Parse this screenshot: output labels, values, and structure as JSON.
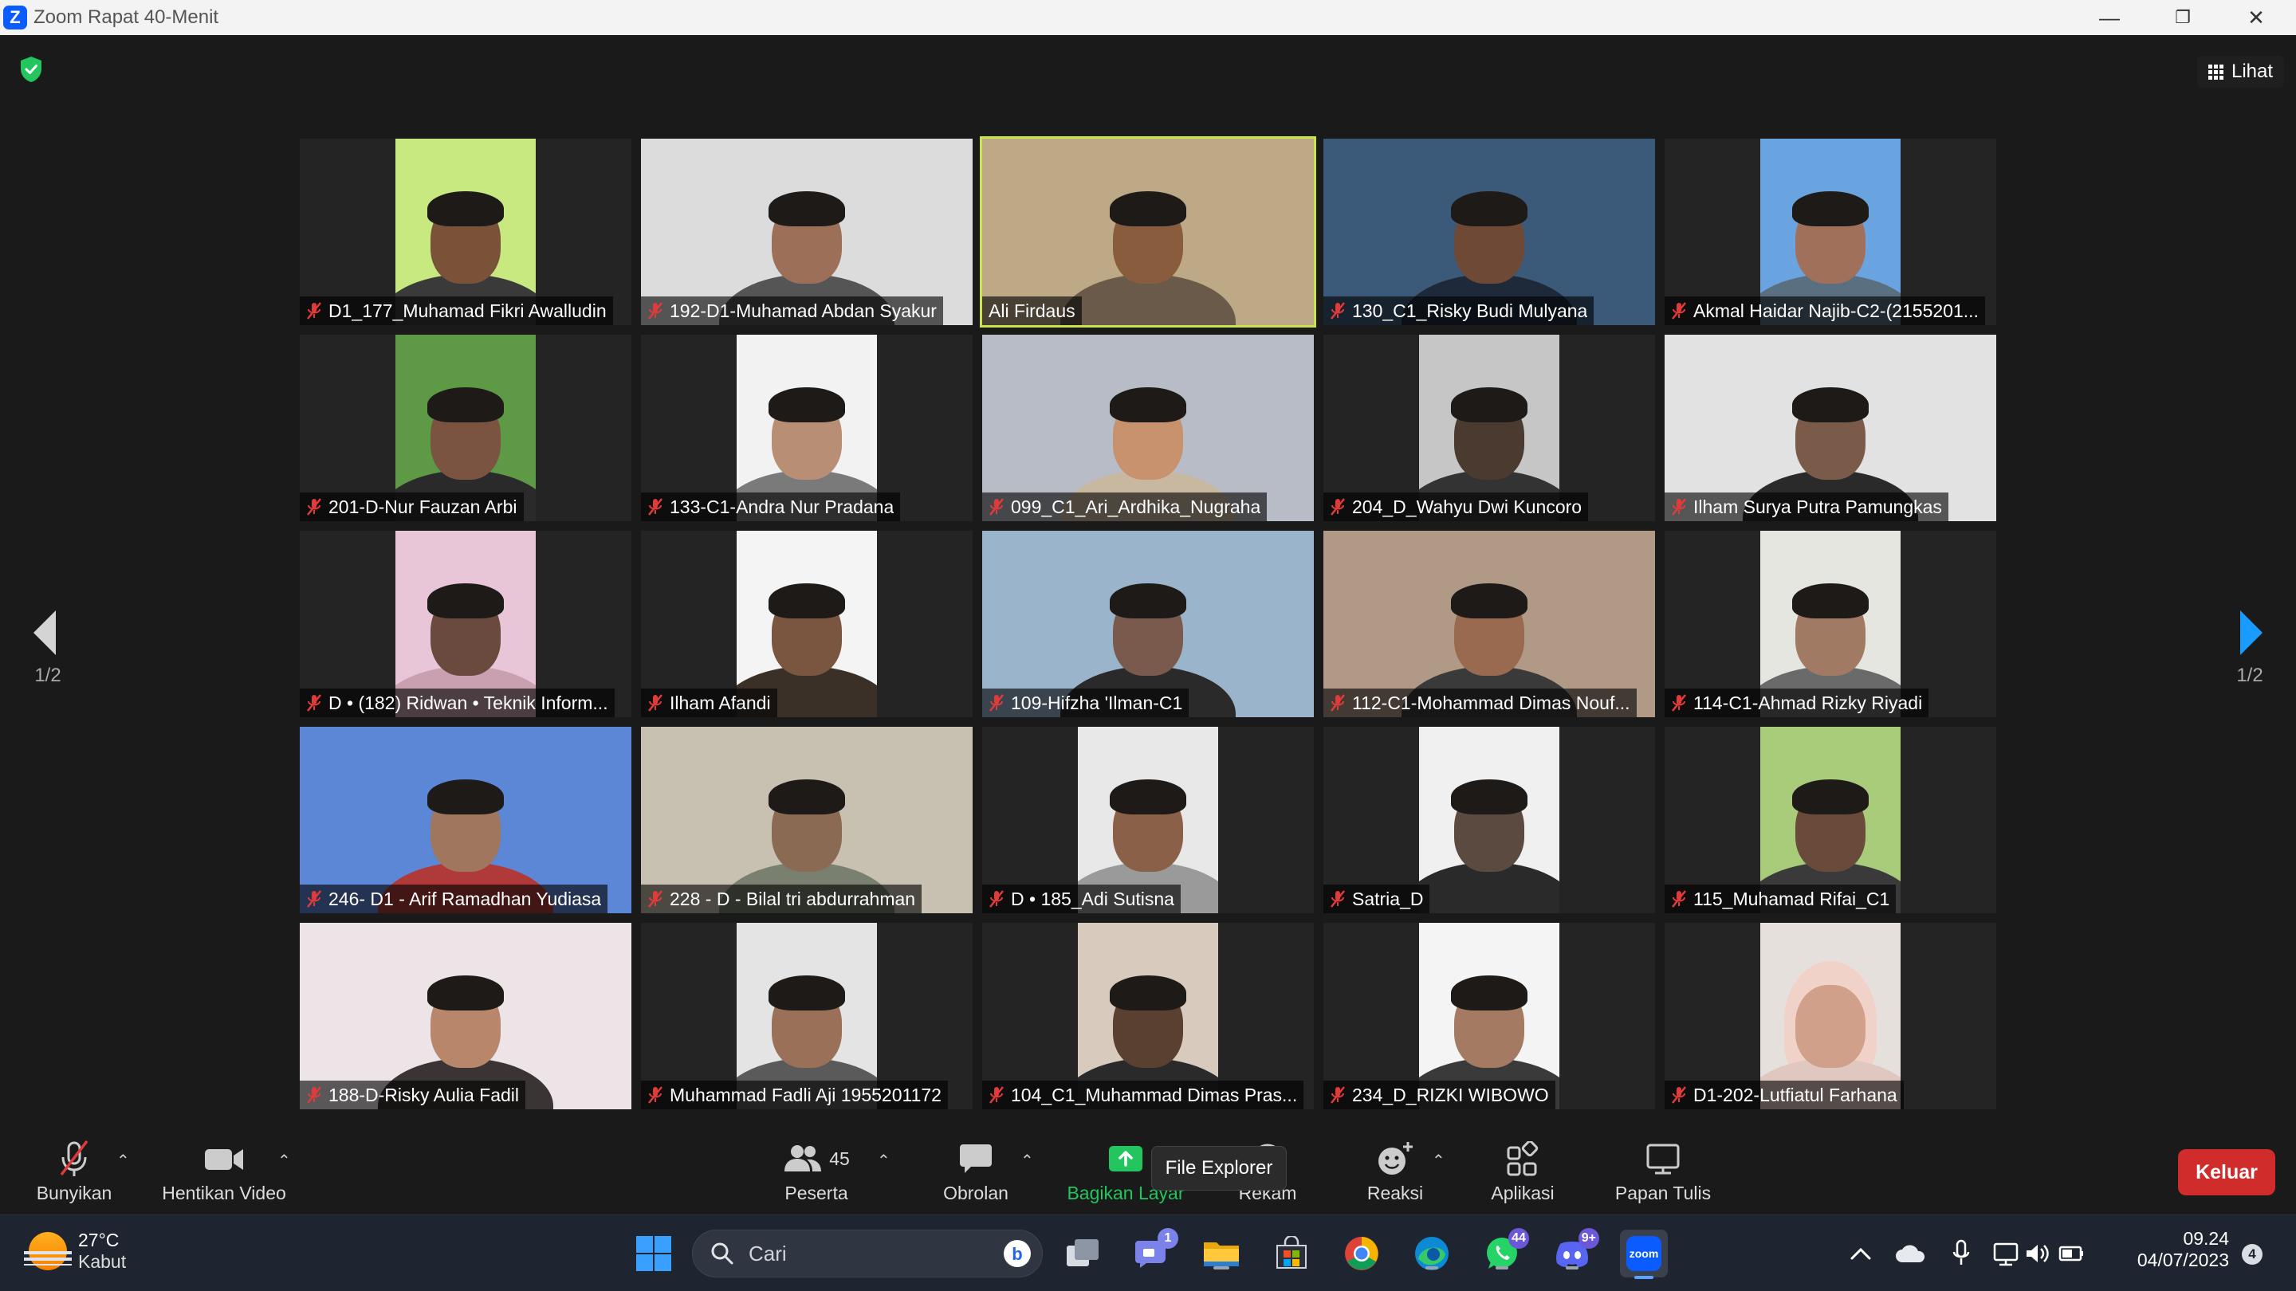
{
  "window": {
    "title": "Zoom Rapat 40-Menit",
    "logo_letter": "Z",
    "minimize": "—",
    "restore": "❐",
    "close": "✕"
  },
  "view_button": {
    "label": "Lihat"
  },
  "pagination": {
    "left": "1/2",
    "right": "1/2"
  },
  "participants": [
    {
      "name": "D1_177_Muhamad Fikri Awalludin",
      "bg": "#c8e880",
      "skin": "#7a5238",
      "shirt": "#3a3a3a",
      "wide": false
    },
    {
      "name": "192-D1-Muhamad Abdan Syakur",
      "bg": "#dcdcdc",
      "skin": "#9c7058",
      "shirt": "#555555",
      "wide": true
    },
    {
      "name": "Ali Firdaus",
      "bg": "#bda985",
      "skin": "#8a5c3e",
      "shirt": "#6a5a4a",
      "wide": true
    },
    {
      "name": "130_C1_Risky Budi Mulyana",
      "bg": "#3b5a7a",
      "skin": "#6e4a36",
      "shirt": "#1e2a3a",
      "wide": true
    },
    {
      "name": "Akmal Haidar Najib-C2-(2155201...",
      "bg": "#6aa4e0",
      "skin": "#a0705a",
      "shirt": "#5a7080",
      "wide": false
    },
    {
      "name": "201-D-Nur Fauzan Arbi",
      "bg": "#5e9a46",
      "skin": "#7a5440",
      "shirt": "#2a2a2a",
      "wide": false
    },
    {
      "name": "133-C1-Andra Nur Pradana",
      "bg": "#f2f2f2",
      "skin": "#b88e74",
      "shirt": "#7a7a7a",
      "wide": false
    },
    {
      "name": "099_C1_Ari_Ardhika_Nugraha",
      "bg": "#b8bcc6",
      "skin": "#c8926e",
      "shirt": "#c8b8a0",
      "wide": true
    },
    {
      "name": "204_D_Wahyu Dwi Kuncoro",
      "bg": "#c6c6c6",
      "skin": "#4a3a30",
      "shirt": "#333333",
      "wide": false
    },
    {
      "name": "Ilham Surya Putra Pamungkas",
      "bg": "#e2e2e2",
      "skin": "#7a5a48",
      "shirt": "#2a2a2a",
      "wide": true
    },
    {
      "name": "D • (182) Ridwan • Teknik Inform...",
      "bg": "#e8c6d8",
      "skin": "#6a4a3e",
      "shirt": "#c8a0b0",
      "wide": false
    },
    {
      "name": "Ilham Afandi",
      "bg": "#f4f4f4",
      "skin": "#7a5640",
      "shirt": "#3a3028",
      "wide": false
    },
    {
      "name": "109-Hifzha 'Ilman-C1",
      "bg": "#9ab4cc",
      "skin": "#7a5a4c",
      "shirt": "#2a2a2a",
      "wide": true
    },
    {
      "name": "112-C1-Mohammad Dimas Nouf...",
      "bg": "#b09a86",
      "skin": "#9a6a50",
      "shirt": "#3a3a3a",
      "wide": true
    },
    {
      "name": "114-C1-Ahmad Rizky Riyadi",
      "bg": "#e6e6e0",
      "skin": "#a07a62",
      "shirt": "#6a6a6a",
      "wide": false
    },
    {
      "name": "246- D1 - Arif Ramadhan Yudiasa",
      "bg": "#5c86d6",
      "skin": "#a0765e",
      "shirt": "#b03a3a",
      "wide": true
    },
    {
      "name": "228 - D - Bilal tri abdurrahman",
      "bg": "#c8c0b0",
      "skin": "#8a6a52",
      "shirt": "#7a8070",
      "wide": true
    },
    {
      "name": "D • 185_Adi Sutisna",
      "bg": "#e8e8e8",
      "skin": "#8a6048",
      "shirt": "#9a9a9a",
      "wide": false
    },
    {
      "name": "Satria_D",
      "bg": "#f0f0f0",
      "skin": "#5a4a40",
      "shirt": "#2a2a2a",
      "wide": false
    },
    {
      "name": "115_Muhamad Rifai_C1",
      "bg": "#a8cc7a",
      "skin": "#6a4a3a",
      "shirt": "#3a3a3a",
      "wide": false
    },
    {
      "name": "188-D-Risky Aulia Fadil",
      "bg": "#ece4e6",
      "skin": "#b8866a",
      "shirt": "#3a3434",
      "wide": true
    },
    {
      "name": "Muhammad Fadli Aji 1955201172",
      "bg": "#e4e4e4",
      "skin": "#9a7058",
      "shirt": "#5a5a5a",
      "wide": false
    },
    {
      "name": "104_C1_Muhammad Dimas Pras...",
      "bg": "#d8cabc",
      "skin": "#5a4030",
      "shirt": "#2a2a2a",
      "wide": false
    },
    {
      "name": "234_D_RIZKI WIBOWO",
      "bg": "#f4f4f4",
      "skin": "#a47a62",
      "shirt": "#3a3a3a",
      "wide": false
    },
    {
      "name": "D1-202-Lutfiatul Farhana",
      "bg": "#e6e0dc",
      "skin": "#d0a08a",
      "shirt": "#e0c8c0",
      "wide": false,
      "hijab": "#f0d2c8"
    }
  ],
  "active_speaker_index": 2,
  "toolbar": {
    "unmute": "Bunyikan",
    "stop_video": "Hentikan Video",
    "participants": "Peserta",
    "participant_count": "45",
    "chat": "Obrolan",
    "share": "Bagikan Layar",
    "record": "Rekam",
    "reactions": "Reaksi",
    "apps": "Aplikasi",
    "whiteboard": "Papan Tulis",
    "leave": "Keluar",
    "tooltip": "File Explorer"
  },
  "taskbar": {
    "temp": "27°C",
    "weather": "Kabut",
    "search_placeholder": "Cari",
    "teams_badge": "1",
    "whatsapp_badge": "44",
    "discord_badge": "9+",
    "zoom_label": "zoom",
    "time": "09.24",
    "date": "04/07/2023",
    "notifications": "4"
  },
  "colors": {
    "active_border": "#c9e34b",
    "share_green": "#22c55e",
    "leave_red": "#d02c2c",
    "arrow_blue": "#1a9bff",
    "zoom_blue": "#0b5cff"
  }
}
